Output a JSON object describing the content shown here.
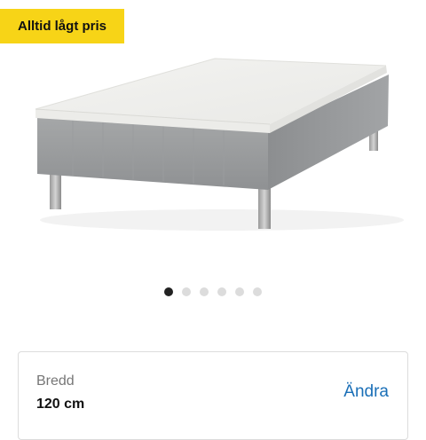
{
  "badge": {
    "label": "Alltid lågt pris",
    "color": "#f7d417"
  },
  "product_image": {
    "subject": "bed",
    "icon": "bed-image"
  },
  "carousel": {
    "total": 6,
    "active_index": 0
  },
  "width_option": {
    "label": "Bredd",
    "value": "120 cm",
    "action_label": "Ändra",
    "action_color": "#1a6fb7"
  }
}
